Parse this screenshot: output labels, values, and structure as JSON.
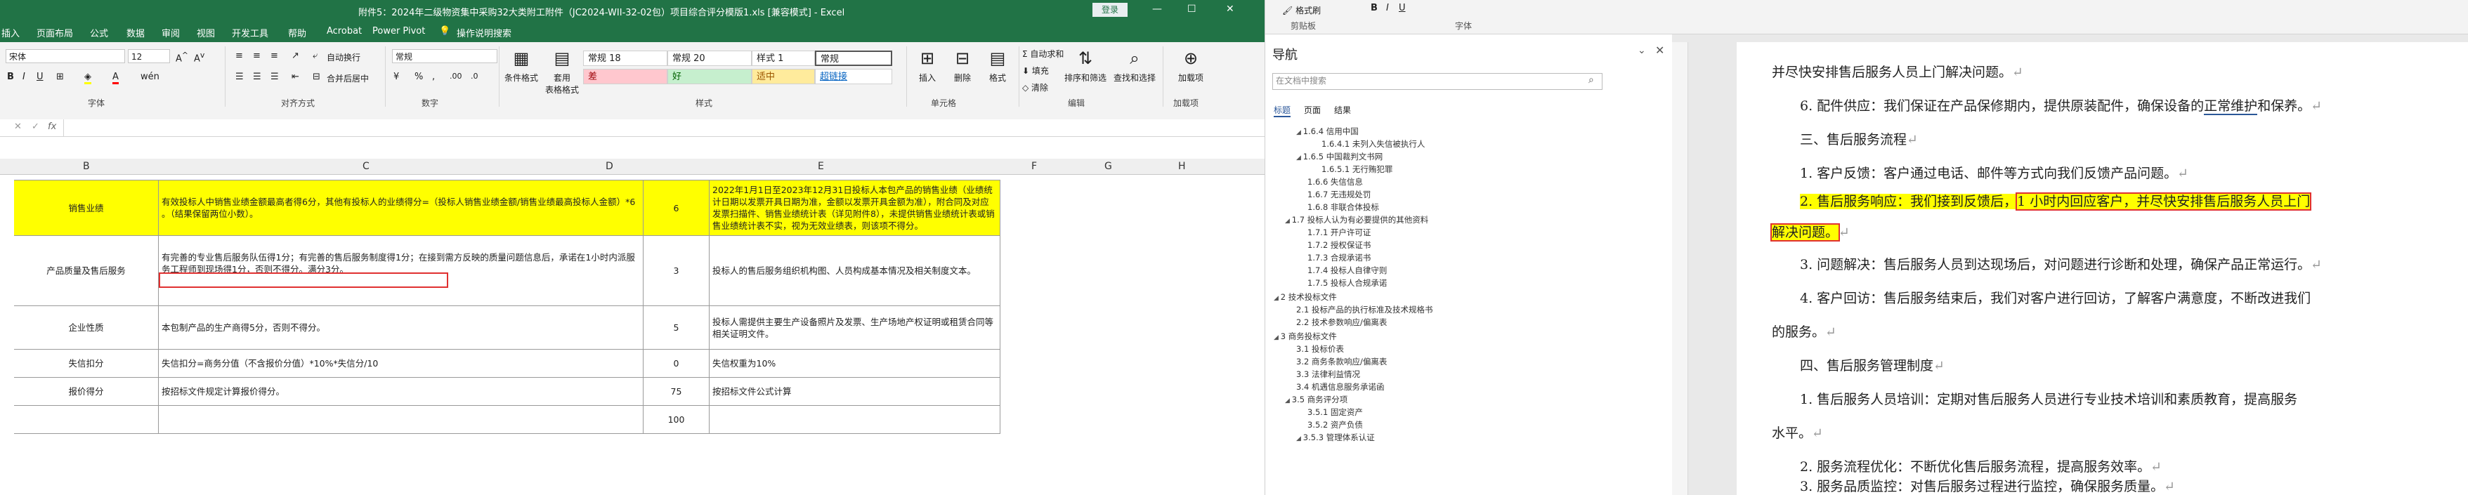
{
  "excel": {
    "title": "附件5：2024年二级物资集中采购32大类附工附件（JC2024-WII-32-02包）项目综合评分模版1.xls  [兼容模式] - Excel",
    "login": "登录",
    "win_min": "—",
    "win_max": "☐",
    "win_close": "✕",
    "tabs": [
      "插入",
      "页面布局",
      "公式",
      "数据",
      "审阅",
      "视图",
      "开发工具",
      "帮助",
      "Acrobat",
      "Power Pivot",
      "操作说明搜索"
    ],
    "font_name": "宋体",
    "font_size": "12",
    "number_format": "常规",
    "wrap_text": "自动换行",
    "merge_center": "合并后居中",
    "groups": [
      "字体",
      "对齐方式",
      "数字",
      "样式",
      "单元格",
      "编辑",
      "加载项"
    ],
    "cond_format": "条件格式",
    "format_table": "套用\n表格格式",
    "styles": [
      "常规 18",
      "常规 20",
      "样式 1",
      "常规",
      "差",
      "好",
      "适中",
      "超链接"
    ],
    "insert": "插入",
    "delete": "删除",
    "format": "格式",
    "autosum": "自动求和",
    "fill": "填充",
    "clear": "清除",
    "sort_filter": "排序和筛选",
    "find_select": "查找和选择",
    "addins": "加载项",
    "formula_bar_x": "✕",
    "formula_bar_check": "✓",
    "formula_bar_fx": "fx",
    "columns": [
      "B",
      "C",
      "D",
      "E",
      "F",
      "G",
      "H"
    ],
    "rows": [
      {
        "b": "销售业绩",
        "c": "有效投标人中销售业绩金额最高者得6分，其他有投标人的业绩得分=（投标人销售业绩金额/销售业绩最高投标人金额）*6 。（结果保留两位小数）。",
        "d": "6",
        "e": "2022年1月1日至2023年12月31日投标人本包产品的销售业绩（业绩统计日期以发票开具日期为准，金额以发票开具金额为准），附合同及对应发票扫描件、销售业绩统计表（详见附件8），未提供销售业绩统计表或销售业绩统计表不实，视为无效业绩表，则该项不得分。"
      },
      {
        "b": "产品质量及售后服务",
        "c1": "有完善的专业售后服务队伍得1分；有完善的售后服务制度得1分；在接到需方反映的质量问题信息后，",
        "c2": "承诺在1小时内派服务工程师到现场得1分，",
        "c3": "否则不得分。满分3分。",
        "d": "3",
        "e": "投标人的售后服务组织机构图、人员构成基本情况及相关制度文本。"
      },
      {
        "b": "企业性质",
        "c": "本包制产品的生产商得5分，否则不得分。",
        "d": "5",
        "e": "投标人需提供主要生产设备照片及发票、生产场地产权证明或租赁合同等相关证明文件。"
      },
      {
        "b": "失信扣分",
        "c": "失信扣分=商务分值（不含报价分值）*10%*失信分/10",
        "d": "0",
        "e": "失信权重为10%"
      },
      {
        "b": "报价得分",
        "c": "按招标文件规定计算报价得分。",
        "d": "75",
        "e": "按招标文件公式计算"
      },
      {
        "b": "",
        "c": "",
        "d": "100",
        "e": ""
      }
    ]
  },
  "nav": {
    "ribbon_labels": [
      "剪贴板",
      "字体",
      "格式刷"
    ],
    "title": "导航",
    "search_placeholder": "在文档中搜索",
    "tabs": [
      "标题",
      "页面",
      "结果"
    ],
    "items": [
      "1.6.4 信用中国",
      "1.6.4.1 未列入失信被执行人",
      "1.6.5 中国裁判文书网",
      "1.6.5.1 无行贿犯罪",
      "1.6.6 失信信息",
      "1.6.7 无违规处罚",
      "1.6.8 非联合体投标",
      "1.7 投标人认为有必要提供的其他资料",
      "1.7.1 开户许可证",
      "1.7.2 授权保证书",
      "1.7.3 合规承诺书",
      "1.7.4 投标人自律守则",
      "1.7.5 投标人合规承诺",
      "2 技术投标文件",
      "2.1 投标产品的执行标准及技术规格书",
      "2.2 技术参数响应/偏离表",
      "3 商务投标文件",
      "3.1 投标价表",
      "3.2 商务条款响应/偏离表",
      "3.3 法律利益情况",
      "3.4 机遇信息服务承诺函",
      "3.5 商务评分项",
      "3.5.1 固定资产",
      "3.5.2 资产负债",
      "3.5.3 管理体系认证"
    ]
  },
  "doc": {
    "paragraphs": [
      {
        "pre": "并尽快安排售后服务人员上门解决问题。"
      },
      {
        "pre": "6. 配件供应：我们保证在产品保修期内，提供原装配件，确保设备的",
        "u": "正常维护",
        "post": "和保养。"
      },
      {
        "pre": "三、售后服务流程"
      },
      {
        "pre": "1. 客户反馈：客户通过电话、邮件等方式向我们反馈产品问题。"
      },
      {
        "hl1": "2. 售后服务响应：我们接到反馈后，",
        "hl2": "1 小时内回应客户，并尽快安排售后服务人员上门"
      },
      {
        "hl3": "解决问题。"
      },
      {
        "pre": "3. 问题解决：售后服务人员到达现场后，对问题进行诊断和处理，确保产品正常运行。"
      },
      {
        "pre": "4. 客户回访：售后服务结束后，我们对客户进行回访，了解客户满意度，不断改进我们"
      },
      {
        "pre": "的服务。"
      },
      {
        "pre": "四、售后服务管理制度"
      },
      {
        "pre": "1. 售后服务人员培训：定期对售后服务人员进行专业技术培训和素质教育，提高服务"
      },
      {
        "pre": "水平。"
      },
      {
        "pre": "2. 服务流程优化：不断优化售后服务流程，提高服务效率。"
      },
      {
        "pre": "3. 服务品质监控：对售后服务过程进行监控，确保服务质量。"
      }
    ],
    "para_mark": "↵"
  },
  "colors": {
    "excel_green": "#217346",
    "highlight": "#ffff00",
    "red_box": "#e03030"
  }
}
